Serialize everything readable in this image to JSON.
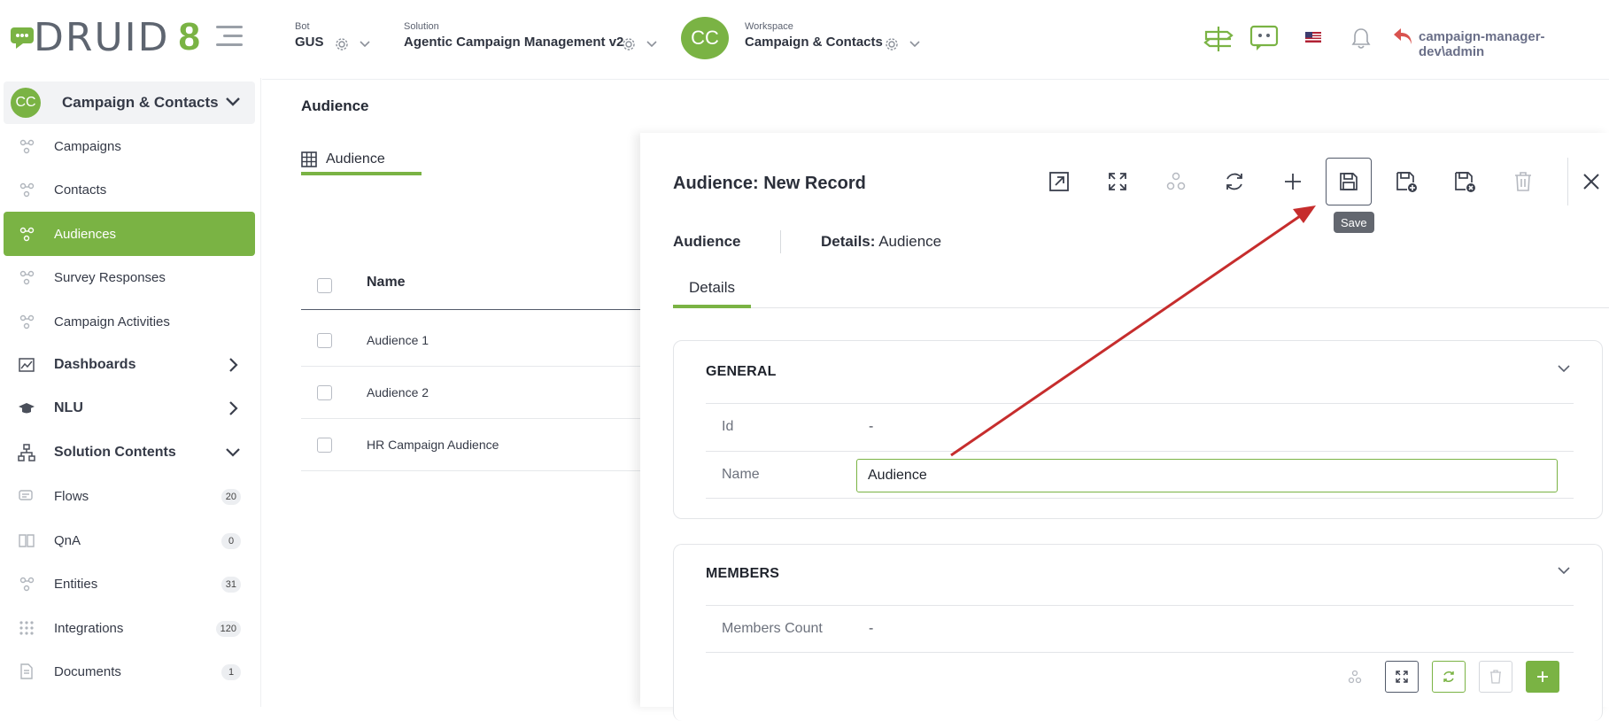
{
  "brand": {
    "logo_text": "DRUID",
    "logo_number": "8",
    "accent_color": "#7ab344"
  },
  "topbar": {
    "bot": {
      "label": "Bot",
      "value": "GUS"
    },
    "solution": {
      "label": "Solution",
      "value": "Agentic Campaign Management v2"
    },
    "workspace": {
      "label": "Workspace",
      "value": "Campaign & Contacts",
      "avatar": "CC"
    },
    "user": "campaign-manager-dev\\admin",
    "icons": [
      "signpost-icon",
      "chat-bot-icon",
      "us-flag-icon",
      "bell-icon",
      "back-arrow-icon"
    ]
  },
  "sidebar": {
    "workspace": {
      "avatar": "CC",
      "title": "Campaign & Contacts"
    },
    "items": [
      {
        "label": "Campaigns",
        "icon": "entity-icon"
      },
      {
        "label": "Contacts",
        "icon": "entity-icon"
      },
      {
        "label": "Audiences",
        "icon": "entity-icon",
        "active": true
      },
      {
        "label": "Survey Responses",
        "icon": "entity-icon"
      },
      {
        "label": "Campaign Activities",
        "icon": "entity-icon"
      },
      {
        "label": "Dashboards",
        "icon": "chart-icon",
        "section": true
      },
      {
        "label": "NLU",
        "icon": "graduation-cap-icon",
        "section": true
      },
      {
        "label": "Solution Contents",
        "icon": "sitemap-icon",
        "section": true
      },
      {
        "label": "Flows",
        "icon": "flow-icon",
        "badge": "20"
      },
      {
        "label": "QnA",
        "icon": "book-icon",
        "badge": "0"
      },
      {
        "label": "Entities",
        "icon": "entity-icon",
        "badge": "31"
      },
      {
        "label": "Integrations",
        "icon": "grid-dots-icon",
        "badge": "120"
      },
      {
        "label": "Documents",
        "icon": "document-icon",
        "badge": "1"
      }
    ]
  },
  "main": {
    "page_title": "Audience",
    "list_tab": "Audience",
    "column_name": "Name",
    "rows": [
      "Audience 1",
      "Audience 2",
      "HR Campaign Audience"
    ]
  },
  "panel": {
    "title": "Audience: New Record",
    "toolbar": [
      "open-new-window-icon",
      "expand-icon",
      "relations-icon",
      "refresh-icon",
      "plus-icon",
      "save-icon",
      "save-and-new-icon",
      "save-and-close-icon",
      "delete-icon",
      "close-icon"
    ],
    "tooltip": "Save",
    "crumb_entity": "Audience",
    "crumb_details_label": "Details:",
    "crumb_details_value": "Audience",
    "tab": "Details",
    "general": {
      "title": "GENERAL",
      "id_label": "Id",
      "id_value": "-",
      "name_label": "Name",
      "name_value": "Audience"
    },
    "members": {
      "title": "MEMBERS",
      "count_label": "Members Count",
      "count_value": "-"
    }
  }
}
